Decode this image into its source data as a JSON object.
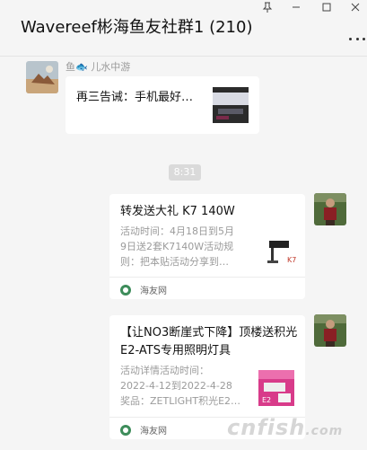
{
  "window": {
    "title": "Wavereef彬海鱼友社群1 (210)",
    "controls": {
      "pin": "⊼",
      "minimize": "—",
      "maximize": "□",
      "close": "✕"
    }
  },
  "messages": {
    "incoming": {
      "sender": "鱼🐟 儿水中游",
      "text": "再三告诫：手机最好…"
    },
    "time_badge": "8:31",
    "cards": [
      {
        "title": "转发送大礼 K7 140W",
        "desc": "活动时间：4月18日到5月\n9日送2套K7140W活动规\n则：把本贴活动分享到…",
        "thumb_text": "K7",
        "source": "海友网"
      },
      {
        "title": "【让NO3断崖式下降】顶楼送积光E2-ATS专用照明灯具",
        "desc": "活动详情活动时间：\n2022-4-12到2022-4-28\n奖品：ZETLIGHT积光E2…",
        "thumb_text": "E2",
        "source": "海友网"
      }
    ]
  },
  "watermark": {
    "main": "cnfish",
    "sub": ".com"
  },
  "colors": {
    "background": "#f5f5f5",
    "bubble": "#ffffff",
    "secondary_text": "#9b9b9b",
    "source_icon": "#3d8c5a"
  }
}
